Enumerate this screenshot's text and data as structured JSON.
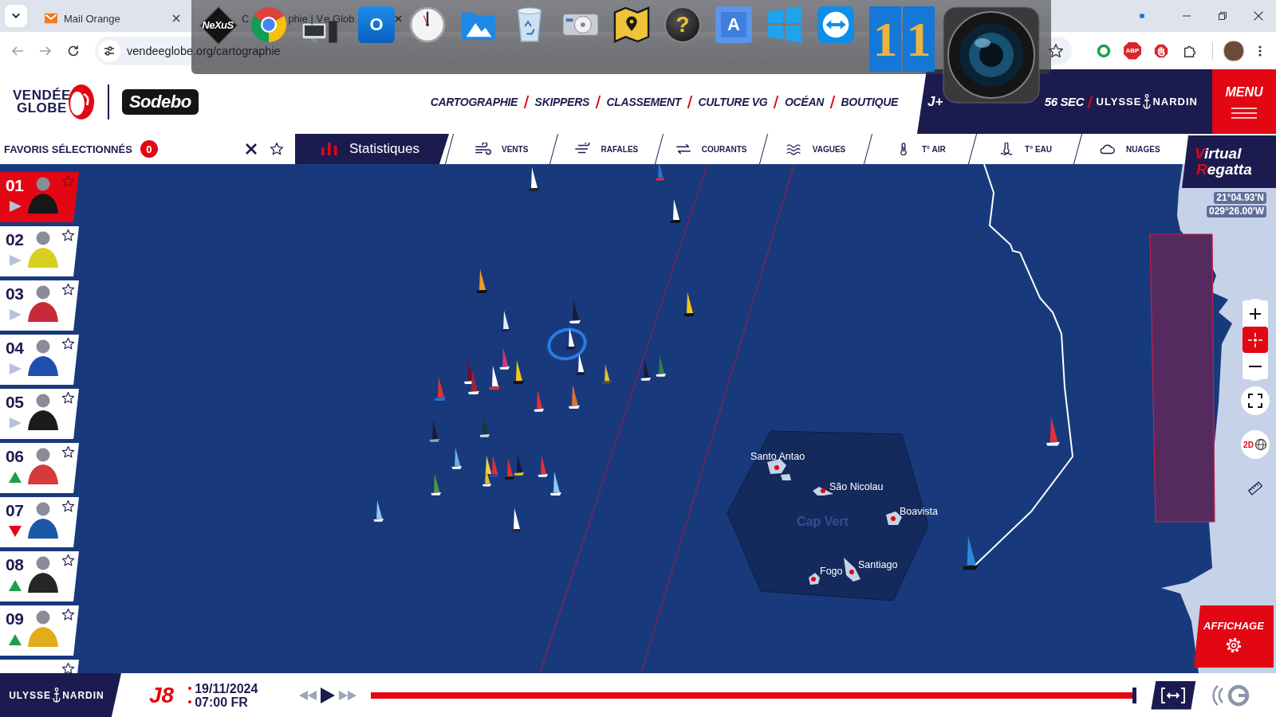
{
  "browser": {
    "tabs": [
      {
        "kind": "mail",
        "title": "Mail Orange"
      },
      {
        "title_parts": [
          "C",
          "phie | V",
          "e Glob"
        ]
      }
    ],
    "url": "vendeeglobe.org/cartographie",
    "extensions": [
      {
        "kind": "ring"
      },
      {
        "kind": "adblock",
        "label": "ABP"
      },
      {
        "kind": "stop-hand"
      },
      {
        "kind": "puzzle"
      }
    ]
  },
  "dock": {
    "items": [
      {
        "kind": "nexus",
        "label": "NeXuS"
      },
      {
        "kind": "ring-logo"
      },
      {
        "kind": "computer"
      },
      {
        "kind": "outlook",
        "label": "O"
      },
      {
        "kind": "clock"
      },
      {
        "kind": "photos"
      },
      {
        "kind": "recycle-bin"
      },
      {
        "kind": "drive"
      },
      {
        "kind": "map"
      },
      {
        "kind": "help",
        "label": "?"
      },
      {
        "kind": "letter-tile",
        "label": "A"
      },
      {
        "kind": "windows"
      },
      {
        "kind": "remote"
      },
      {
        "kind": "number-tile",
        "label": "1"
      },
      {
        "kind": "number-tile",
        "label": "1"
      },
      {
        "kind": "lens"
      }
    ]
  },
  "header": {
    "logo": {
      "line_1": "VENDÉE",
      "line_2": "GLOBE"
    },
    "sponsor": "Sodebo",
    "nav": [
      "CARTOGRAPHIE",
      "SKIPPERS",
      "CLASSEMENT",
      "CULTURE VG",
      "OCÉAN",
      "BOUTIQUE"
    ],
    "countdown": {
      "prefix": "J+",
      "value": "56 SEC"
    },
    "partner": {
      "left": "ULYSSE",
      "right": "NARDIN"
    },
    "menu": "MENU"
  },
  "toolbar": {
    "favorites": {
      "label": "FAVORIS SÉLECTIONNÉS",
      "count": "0"
    },
    "stats": {
      "label": "Statistiques",
      "selected": true
    },
    "layers": [
      {
        "kind": "wind",
        "label": "VENTS",
        "selected": false
      },
      {
        "kind": "gusts",
        "label": "RAFALES",
        "selected": false
      },
      {
        "kind": "currents",
        "label": "COURANTS",
        "selected": false
      },
      {
        "kind": "waves",
        "label": "VAGUES",
        "selected": false
      },
      {
        "kind": "air-temperature",
        "label": "T° AIR",
        "selected": false
      },
      {
        "kind": "water-temperature",
        "label": "T° EAU",
        "selected": false
      },
      {
        "kind": "clouds",
        "label": "NUAGES",
        "selected": false
      }
    ]
  },
  "game_logo": {
    "line_1": "Virtual",
    "line_2": "Regatta"
  },
  "skippers": [
    {
      "rank": "01",
      "kind": "steady",
      "selected": true,
      "favorite": false
    },
    {
      "rank": "02",
      "kind": "steady",
      "selected": false,
      "favorite": false
    },
    {
      "rank": "03",
      "kind": "steady",
      "selected": false,
      "favorite": false
    },
    {
      "rank": "04",
      "kind": "steady",
      "selected": false,
      "favorite": false
    },
    {
      "rank": "05",
      "kind": "steady",
      "selected": false,
      "favorite": false
    },
    {
      "rank": "06",
      "kind": "up",
      "selected": false,
      "favorite": false
    },
    {
      "rank": "07",
      "kind": "down",
      "selected": false,
      "favorite": false
    },
    {
      "rank": "08",
      "kind": "up",
      "selected": false,
      "favorite": false
    },
    {
      "rank": "09",
      "kind": "up",
      "selected": false,
      "favorite": false
    },
    {
      "selected": false,
      "favorite": false
    }
  ],
  "map": {
    "coordinates": [
      "21°04.93'N",
      "029°26.00'W"
    ],
    "zone_label": "Cap Vert",
    "islands": [
      {
        "name": "Santo Antao"
      },
      {
        "name": "São Nicolau"
      },
      {
        "name": "Boavista"
      },
      {
        "name": "Fogo"
      },
      {
        "name": "Santiago"
      }
    ],
    "zoom_controls": [
      {
        "kind": "zoom-in",
        "selected": false
      },
      {
        "kind": "locate",
        "selected": true
      },
      {
        "kind": "zoom-out",
        "selected": false
      }
    ],
    "tools": [
      {
        "kind": "fullscreen"
      },
      {
        "kind": "view-mode",
        "label": "2D"
      },
      {
        "kind": "ruler"
      }
    ],
    "display_button": "AFFICHAGE"
  },
  "timeline": {
    "partner": {
      "left": "ULYSSE",
      "right": "NARDIN"
    },
    "day": "J8",
    "date": "19/11/2024",
    "time": "07:00 FR",
    "level": 1
  }
}
